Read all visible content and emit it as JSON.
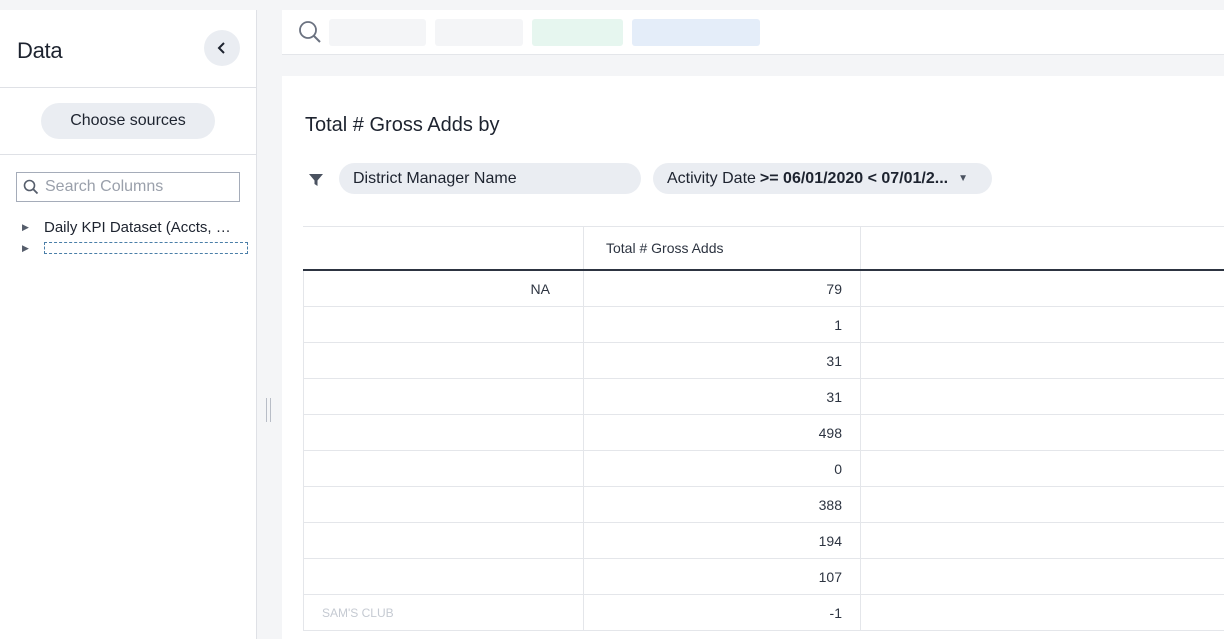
{
  "sidebar": {
    "title": "Data",
    "collapse_icon": "chevron-left-icon",
    "choose_sources_label": "Choose sources",
    "search_placeholder": "Search Columns",
    "tree": [
      {
        "label": "Daily KPI Dataset (Accts, …",
        "expanded": false
      },
      {
        "label": "",
        "expanded": false,
        "selected": true
      }
    ]
  },
  "search_bar": {
    "icon": "search-icon",
    "tokens": [
      {
        "text": "",
        "color": "#f4f5f7"
      },
      {
        "text": "",
        "color": "#f4f5f7"
      },
      {
        "text": "",
        "color": "#e6f6ef"
      },
      {
        "text": "",
        "color": "#e4edf9"
      }
    ]
  },
  "answer": {
    "title": "Total # Gross Adds by",
    "filters": [
      {
        "name": "District Manager Name",
        "value": ""
      },
      {
        "name": "Activity Date",
        "value": ">= 06/01/2020 < 07/01/2..."
      }
    ]
  },
  "table": {
    "headers": [
      "",
      "Total # Gross Adds",
      ""
    ],
    "rows": [
      {
        "name": "NA",
        "value": "79",
        "align": "right"
      },
      {
        "name": "",
        "value": "1",
        "align": "left"
      },
      {
        "name": "",
        "value": "31",
        "align": "right"
      },
      {
        "name": "",
        "value": "31",
        "align": "right"
      },
      {
        "name": "",
        "value": "498",
        "align": "left"
      },
      {
        "name": "",
        "value": "0",
        "align": "right"
      },
      {
        "name": "",
        "value": "388",
        "align": "right"
      },
      {
        "name": "",
        "value": "194",
        "align": "left"
      },
      {
        "name": "",
        "value": "107",
        "align": "right"
      },
      {
        "name": "SAM'S CLUB",
        "value": "-1",
        "align": "left"
      }
    ]
  }
}
